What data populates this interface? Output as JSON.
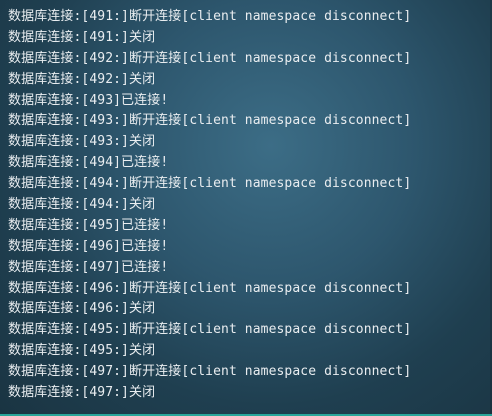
{
  "terminal": {
    "lines": [
      "数据库连接:[491:]断开连接[client namespace disconnect]",
      "数据库连接:[491:]关闭",
      "数据库连接:[492:]断开连接[client namespace disconnect]",
      "数据库连接:[492:]关闭",
      "数据库连接:[493]已连接!",
      "数据库连接:[493:]断开连接[client namespace disconnect]",
      "数据库连接:[493:]关闭",
      "数据库连接:[494]已连接!",
      "数据库连接:[494:]断开连接[client namespace disconnect]",
      "数据库连接:[494:]关闭",
      "数据库连接:[495]已连接!",
      "数据库连接:[496]已连接!",
      "数据库连接:[497]已连接!",
      "数据库连接:[496:]断开连接[client namespace disconnect]",
      "数据库连接:[496:]关闭",
      "数据库连接:[495:]断开连接[client namespace disconnect]",
      "数据库连接:[495:]关闭",
      "数据库连接:[497:]断开连接[client namespace disconnect]",
      "数据库连接:[497:]关闭"
    ]
  },
  "colors": {
    "text": "#e9edf0",
    "background_center": "#3c6d86",
    "background_edge": "#1a3442",
    "accent_bar": "#2db8a8"
  }
}
